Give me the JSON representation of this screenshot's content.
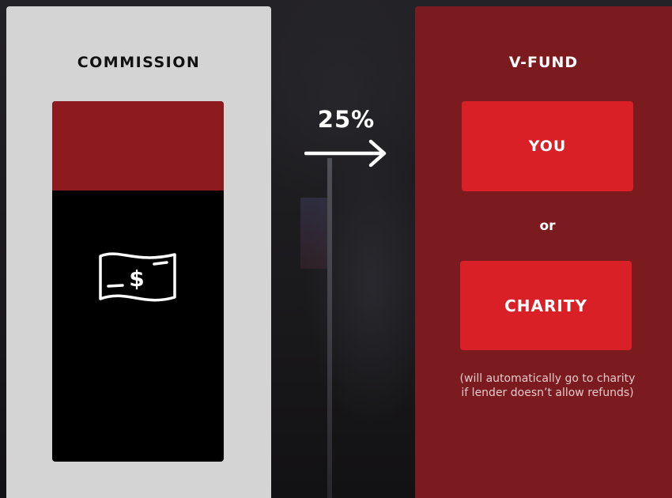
{
  "commission": {
    "title": "COMMISSION",
    "bar_top_color": "#8c1a1e",
    "icon": "money-bill-icon"
  },
  "transfer": {
    "percent": "25%",
    "icon": "arrow-right-icon"
  },
  "vfund": {
    "title": "V-FUND",
    "you_label": "YOU",
    "or_label": "or",
    "charity_label": "CHARITY",
    "note": "(will automatically go to charity if lender doesn’t allow refunds)",
    "button_color": "#d92027",
    "panel_color": "#7c1b1f"
  }
}
